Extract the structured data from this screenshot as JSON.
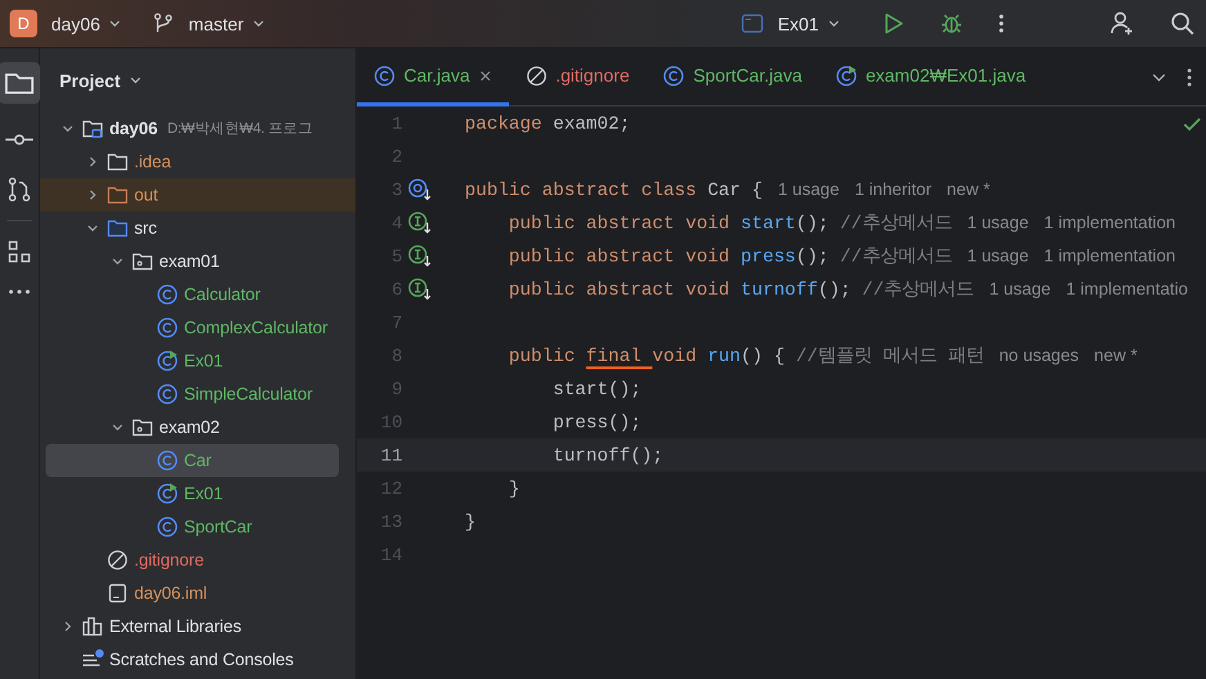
{
  "toolbar": {
    "project_badge": "D",
    "project": "day06",
    "branch": "master",
    "run_config": "Ex01"
  },
  "project_panel": {
    "title": "Project",
    "tree": [
      {
        "label": "day06",
        "path": "D:₩박세현₩4. 프로그",
        "kind": "module",
        "expanded": true,
        "selected": false,
        "excluded": false,
        "color": "#dfe1e5",
        "children": [
          {
            "label": ".idea",
            "kind": "folder",
            "expanded": false,
            "selected": false,
            "excluded": false,
            "color": "#d5915d"
          },
          {
            "label": "out",
            "kind": "folder-excluded",
            "expanded": false,
            "selected": false,
            "excluded": true,
            "color": "#d5915d"
          },
          {
            "label": "src",
            "kind": "source-folder",
            "expanded": true,
            "selected": false,
            "excluded": false,
            "color": "#dfe1e5",
            "children": [
              {
                "label": "exam01",
                "kind": "package",
                "expanded": true,
                "selected": false,
                "excluded": false,
                "color": "#dfe1e5",
                "children": [
                  {
                    "label": "Calculator",
                    "kind": "class",
                    "selected": false,
                    "excluded": false,
                    "color": "#5fb865"
                  },
                  {
                    "label": "ComplexCalculator",
                    "kind": "class",
                    "selected": false,
                    "excluded": false,
                    "color": "#5fb865"
                  },
                  {
                    "label": "Ex01",
                    "kind": "runnable-class",
                    "selected": false,
                    "excluded": false,
                    "color": "#5fb865"
                  },
                  {
                    "label": "SimpleCalculator",
                    "kind": "class",
                    "selected": false,
                    "excluded": false,
                    "color": "#5fb865"
                  }
                ]
              },
              {
                "label": "exam02",
                "kind": "package",
                "expanded": true,
                "selected": false,
                "excluded": false,
                "color": "#dfe1e5",
                "children": [
                  {
                    "label": "Car",
                    "kind": "class",
                    "selected": true,
                    "excluded": false,
                    "color": "#5fb865"
                  },
                  {
                    "label": "Ex01",
                    "kind": "runnable-class",
                    "selected": false,
                    "excluded": false,
                    "color": "#5fb865"
                  },
                  {
                    "label": "SportCar",
                    "kind": "class",
                    "selected": false,
                    "excluded": false,
                    "color": "#5fb865"
                  }
                ]
              }
            ]
          },
          {
            "label": ".gitignore",
            "kind": "ignore-file",
            "selected": false,
            "excluded": false,
            "color": "#e06c63"
          },
          {
            "label": "day06.iml",
            "kind": "module-file",
            "selected": false,
            "excluded": false,
            "color": "#d5915d"
          }
        ]
      },
      {
        "label": "External Libraries",
        "kind": "libraries",
        "expanded": false,
        "selected": false,
        "excluded": false,
        "color": "#dfe1e5"
      },
      {
        "label": "Scratches and Consoles",
        "kind": "scratches",
        "selected": false,
        "excluded": false,
        "color": "#dfe1e5"
      }
    ]
  },
  "tabs": [
    {
      "label": "Car.java",
      "kind": "class",
      "selected": true,
      "closable": true,
      "color": "#5fb865"
    },
    {
      "label": ".gitignore",
      "kind": "ignore-file",
      "selected": false,
      "closable": false,
      "color": "#e06c63"
    },
    {
      "label": "SportCar.java",
      "kind": "class",
      "selected": false,
      "closable": false,
      "color": "#5fb865"
    },
    {
      "label": "exam02₩Ex01.java",
      "kind": "runnable-class",
      "selected": false,
      "closable": false,
      "color": "#5fb865"
    }
  ],
  "editor": {
    "lines": [
      {
        "number": "1",
        "kind": "plain",
        "current": false,
        "segments": [
          {
            "text": "package ",
            "kind": "keyword"
          },
          {
            "text": "exam02;",
            "kind": "plain"
          }
        ]
      },
      {
        "number": "2",
        "kind": "plain",
        "current": false
      },
      {
        "number": "3",
        "kind": "inherited",
        "current": false,
        "segments": [
          {
            "text": "public abstract class ",
            "kind": "keyword"
          },
          {
            "text": "Car {",
            "kind": "plain"
          },
          {
            "text": "1 usage",
            "kind": "hint"
          },
          {
            "text": "1 inheritor",
            "kind": "hint"
          },
          {
            "text": "new *",
            "kind": "hint"
          }
        ]
      },
      {
        "number": "4",
        "kind": "implemented",
        "current": false,
        "segments": [
          {
            "text": "    public abstract void ",
            "kind": "keyword"
          },
          {
            "text": "start",
            "kind": "method"
          },
          {
            "text": "(); ",
            "kind": "plain"
          },
          {
            "text": "//추상메서드",
            "kind": "comment"
          },
          {
            "text": "1 usage",
            "kind": "hint"
          },
          {
            "text": "1 implementation",
            "kind": "hint"
          }
        ]
      },
      {
        "number": "5",
        "kind": "implemented",
        "current": false,
        "segments": [
          {
            "text": "    public abstract void ",
            "kind": "keyword"
          },
          {
            "text": "press",
            "kind": "method"
          },
          {
            "text": "(); ",
            "kind": "plain"
          },
          {
            "text": "//추상메서드",
            "kind": "comment"
          },
          {
            "text": "1 usage",
            "kind": "hint"
          },
          {
            "text": "1 implementation",
            "kind": "hint"
          }
        ]
      },
      {
        "number": "6",
        "kind": "implemented",
        "current": false,
        "segments": [
          {
            "text": "    public abstract void ",
            "kind": "keyword"
          },
          {
            "text": "turnoff",
            "kind": "method"
          },
          {
            "text": "(); ",
            "kind": "plain"
          },
          {
            "text": "//추상메서드",
            "kind": "comment"
          },
          {
            "text": "1 usage",
            "kind": "hint"
          },
          {
            "text": "1 implementatio",
            "kind": "hint"
          }
        ]
      },
      {
        "number": "7",
        "kind": "plain",
        "current": false
      },
      {
        "number": "8",
        "kind": "plain",
        "current": false,
        "segments": [
          {
            "text": "    public ",
            "kind": "keyword"
          },
          {
            "text": "final ",
            "kind": "keyword-warning"
          },
          {
            "text": "void ",
            "kind": "keyword"
          },
          {
            "text": "run",
            "kind": "method"
          },
          {
            "text": "() { ",
            "kind": "plain"
          },
          {
            "text": "//템플릿 메서드 패턴",
            "kind": "comment"
          },
          {
            "text": "no usages",
            "kind": "hint"
          },
          {
            "text": "new *",
            "kind": "hint"
          }
        ]
      },
      {
        "number": "9",
        "kind": "plain",
        "current": false,
        "segments": [
          {
            "text": "        start();",
            "kind": "plain"
          }
        ]
      },
      {
        "number": "10",
        "kind": "plain",
        "current": false,
        "segments": [
          {
            "text": "        press();",
            "kind": "plain"
          }
        ]
      },
      {
        "number": "11",
        "kind": "plain",
        "current": true,
        "segments": [
          {
            "text": "        turnoff();",
            "kind": "plain"
          }
        ]
      },
      {
        "number": "12",
        "kind": "plain",
        "current": false,
        "segments": [
          {
            "text": "    }",
            "kind": "plain"
          }
        ]
      },
      {
        "number": "13",
        "kind": "plain",
        "current": false,
        "segments": [
          {
            "text": "}",
            "kind": "plain"
          }
        ]
      },
      {
        "number": "14",
        "kind": "plain",
        "current": false
      }
    ]
  }
}
